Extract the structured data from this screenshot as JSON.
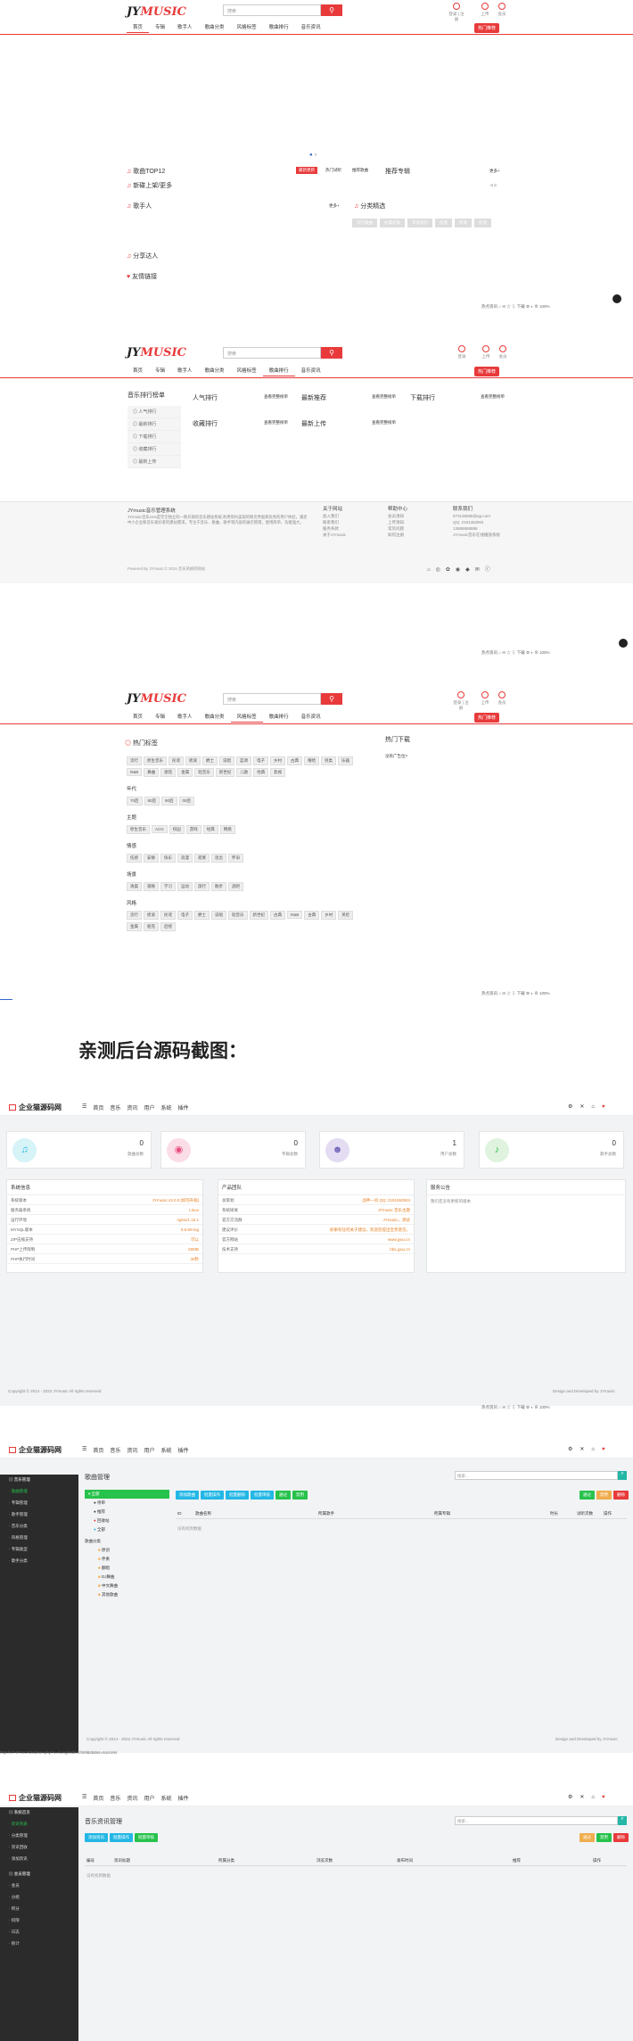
{
  "site": {
    "logo": "JYMUSIC",
    "logo_a": "JY",
    "logo_b": "MUSIC",
    "search_placeholder": "搜索",
    "search_icon": "search-icon",
    "user_links": [
      "登录",
      "上传",
      "会员"
    ],
    "login_text": "登录 | 注册",
    "hot_badge": "热门推荐"
  },
  "nav": [
    "首页",
    "专辑",
    "歌手人",
    "歌曲分类",
    "风格标签",
    "歌曲排行",
    "音乐资讯"
  ],
  "home": {
    "sections": [
      "歌曲TOP12",
      "新碟上架/更多",
      "歌手人",
      "分享达人",
      "友情链接"
    ],
    "tabs": [
      "最新更新",
      "热门试听",
      "推荐歌曲"
    ],
    "recommend_title": "推荐专辑",
    "more": "更多+",
    "category_title": "分类精选",
    "category_tags": [
      "流行歌曲",
      "经典老歌",
      "华语流行",
      "伤感",
      "摇滚",
      "民谣"
    ]
  },
  "status_bar": [
    "热点资讯",
    "下载",
    "100%"
  ],
  "rank": {
    "title": "音乐排行榜单",
    "side": [
      "人气排行",
      "最新排行",
      "下载排行",
      "收藏排行",
      "最新上传"
    ],
    "blocks": [
      "人气排行",
      "最新推荐",
      "下载排行",
      "收藏排行",
      "最新上传"
    ],
    "link": "查看完整榜单"
  },
  "footer": {
    "about_title": "JYmusic音乐管理系统",
    "about_text": "JYmusic音乐cms是完全独立的一款开源的音乐建站系统,利用简约美观的网页界面和优秀的用户体验，满足中小企业和音乐爱好者的建站需求。专注于音乐、歌曲、歌手等内容的展示管理，使用简单，功能强大。",
    "col1_title": "关于网站",
    "col1": [
      "加入我们",
      "联系我们",
      "服务条款",
      "关于JYmusic"
    ],
    "col2_title": "帮助中心",
    "col2": [
      "会员须知",
      "上传须知",
      "常见问题",
      "如何注册"
    ],
    "col3_title": "联系我们",
    "col3": [
      "573135585@qq.com",
      "QQ: 2191362904",
      "13888888888",
      "JYmusic音乐在线播放系统"
    ],
    "powered": "Powered By JYmusic © 2015 音乐风格的网站"
  },
  "tags": {
    "title": "热门标签",
    "download_title": "热门下载",
    "download_text": "没有广告位?",
    "groups": [
      {
        "name": "",
        "items": [
          "流行",
          "原生音乐",
          "民谣",
          "摇滚",
          "爵士",
          "说唱",
          "蓝调",
          "电子",
          "乡村",
          "古典",
          "嘻哈",
          "另类",
          "乐器",
          "R&B",
          "舞曲",
          "朋克",
          "金属",
          "轻音乐",
          "新世纪",
          "儿歌",
          "经典",
          "影视"
        ]
      },
      {
        "name": "年代",
        "items": [
          "70后",
          "80后",
          "90后",
          "00后"
        ]
      },
      {
        "name": "主题",
        "items": [
          "原生音乐",
          "ACG",
          "校园",
          "游戏",
          "经典",
          "网络"
        ]
      },
      {
        "name": "情感",
        "items": [
          "伤感",
          "安静",
          "快乐",
          "浪漫",
          "寂寞",
          "思念",
          "怀旧"
        ]
      },
      {
        "name": "场景",
        "items": [
          "清晨",
          "夜晚",
          "学习",
          "运动",
          "旅行",
          "散步",
          "酒吧"
        ]
      },
      {
        "name": "风格",
        "items": [
          "流行",
          "摇滚",
          "民谣",
          "电子",
          "爵士",
          "说唱",
          "轻音乐",
          "新世纪",
          "古典",
          "R&B",
          "古典",
          "乡村",
          "英伦",
          "金属",
          "朋克",
          "后摇"
        ]
      }
    ]
  },
  "admin_heading": "亲测后台源码截图：",
  "admin": {
    "logo": "企业猫源码网",
    "menu": [
      "首页",
      "音乐",
      "资讯",
      "用户",
      "系统",
      "插件"
    ],
    "stats": [
      {
        "value": "0",
        "label": "歌曲总数"
      },
      {
        "value": "0",
        "label": "专辑总数"
      },
      {
        "value": "1",
        "label": "用户总数"
      },
      {
        "value": "0",
        "label": "歌手总数"
      }
    ],
    "sys_title": "系统信息",
    "sys_rows": [
      [
        "系统版本",
        "JYmusic v3.0.0 [如何升级]"
      ],
      [
        "服务器系统",
        "Linux"
      ],
      [
        "运行环境",
        "nginx/1.16.1"
      ],
      [
        "MYSQL版本",
        "5.6.50-log"
      ],
      [
        "ZIP压缩支持",
        "可以"
      ],
      [
        "PHP上传限制",
        "50MB"
      ],
      [
        "PHP执行时间",
        "30秒"
      ]
    ],
    "prod_title": "产品团队",
    "prod_rows": [
      [
        "总策划",
        "战神一问 QQ: 2191362904"
      ],
      [
        "系统研发",
        "JYmusic 音乐主题"
      ],
      [
        "官方交流群",
        "JYmusic，测试"
      ],
      [
        "建议评价",
        "如果有任何关于建议，欢迎您提出宝贵意见。"
      ],
      [
        "官方网站",
        "www.jyuu.cn"
      ],
      [
        "技术支持",
        "bbs.jyuu.cn"
      ]
    ],
    "notice_title": "服务公告",
    "notice_text": "我们还没有更新的版本",
    "footer_left": "Copyright © 2014 - 2022 JYmusic All rights reserved",
    "footer_right": "Design and Developed by JYmusic"
  },
  "songs": {
    "title": "歌曲管理",
    "search_placeholder": "搜索...",
    "side": [
      "系统首页",
      "歌曲管理",
      "专辑管理",
      "歌手管理",
      "音乐分类",
      "风格管理",
      "专辑类型",
      "歌手分类"
    ],
    "side_head": "音乐管理",
    "tree_title": "全部",
    "tree": [
      "待审",
      "推荐",
      "回收站",
      "全部"
    ],
    "tree2_title": "歌曲分类",
    "tree2": [
      "原创",
      "伴奏",
      "翻唱",
      "DJ舞曲",
      "中文舞曲",
      "其他歌曲"
    ],
    "toolbar": [
      "添加歌曲",
      "批量操作",
      "批量删除",
      "批量审核",
      "通过",
      "禁用"
    ],
    "cols": [
      "ID",
      "歌曲名称",
      "所属歌手",
      "所属专辑",
      "时长",
      "试听次数",
      "操作"
    ],
    "empty": "没有找到数据",
    "url": "http://47.97.8.172/admin.php?s=/song/index.html&status=success",
    "right_btns": [
      "通过",
      "禁用",
      "删除"
    ]
  },
  "news": {
    "title": "音乐资讯管理",
    "search_placeholder": "搜索...",
    "toolbar": [
      "添加资讯",
      "批量操作",
      "批量审核"
    ],
    "cols": [
      "编号",
      "资讯标题",
      "所属分类",
      "浏览次数",
      "发布时间",
      "推荐",
      "操作"
    ],
    "empty": "没有找到数据",
    "side": [
      "系统首页",
      "资讯列表",
      "分类管理",
      "资讯回收",
      "添加资讯"
    ],
    "side2_head": "会员管理",
    "side2": [
      "会员",
      "分组",
      "积分",
      "权限",
      "日志",
      "统计"
    ]
  }
}
